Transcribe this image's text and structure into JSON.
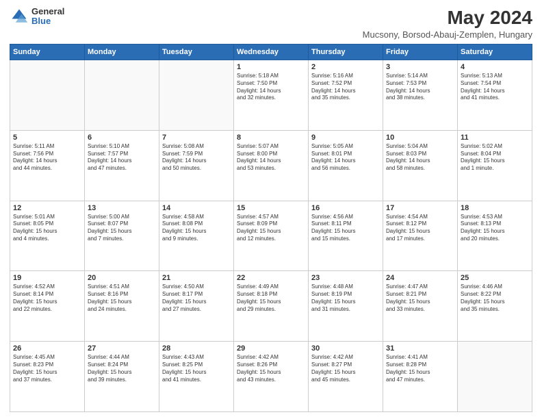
{
  "header": {
    "logo_line1": "General",
    "logo_line2": "Blue",
    "title": "May 2024",
    "subtitle": "Mucsony, Borsod-Abauj-Zemplen, Hungary"
  },
  "weekdays": [
    "Sunday",
    "Monday",
    "Tuesday",
    "Wednesday",
    "Thursday",
    "Friday",
    "Saturday"
  ],
  "weeks": [
    [
      {
        "day": "",
        "info": ""
      },
      {
        "day": "",
        "info": ""
      },
      {
        "day": "",
        "info": ""
      },
      {
        "day": "1",
        "info": "Sunrise: 5:18 AM\nSunset: 7:50 PM\nDaylight: 14 hours\nand 32 minutes."
      },
      {
        "day": "2",
        "info": "Sunrise: 5:16 AM\nSunset: 7:52 PM\nDaylight: 14 hours\nand 35 minutes."
      },
      {
        "day": "3",
        "info": "Sunrise: 5:14 AM\nSunset: 7:53 PM\nDaylight: 14 hours\nand 38 minutes."
      },
      {
        "day": "4",
        "info": "Sunrise: 5:13 AM\nSunset: 7:54 PM\nDaylight: 14 hours\nand 41 minutes."
      }
    ],
    [
      {
        "day": "5",
        "info": "Sunrise: 5:11 AM\nSunset: 7:56 PM\nDaylight: 14 hours\nand 44 minutes."
      },
      {
        "day": "6",
        "info": "Sunrise: 5:10 AM\nSunset: 7:57 PM\nDaylight: 14 hours\nand 47 minutes."
      },
      {
        "day": "7",
        "info": "Sunrise: 5:08 AM\nSunset: 7:59 PM\nDaylight: 14 hours\nand 50 minutes."
      },
      {
        "day": "8",
        "info": "Sunrise: 5:07 AM\nSunset: 8:00 PM\nDaylight: 14 hours\nand 53 minutes."
      },
      {
        "day": "9",
        "info": "Sunrise: 5:05 AM\nSunset: 8:01 PM\nDaylight: 14 hours\nand 56 minutes."
      },
      {
        "day": "10",
        "info": "Sunrise: 5:04 AM\nSunset: 8:03 PM\nDaylight: 14 hours\nand 58 minutes."
      },
      {
        "day": "11",
        "info": "Sunrise: 5:02 AM\nSunset: 8:04 PM\nDaylight: 15 hours\nand 1 minute."
      }
    ],
    [
      {
        "day": "12",
        "info": "Sunrise: 5:01 AM\nSunset: 8:05 PM\nDaylight: 15 hours\nand 4 minutes."
      },
      {
        "day": "13",
        "info": "Sunrise: 5:00 AM\nSunset: 8:07 PM\nDaylight: 15 hours\nand 7 minutes."
      },
      {
        "day": "14",
        "info": "Sunrise: 4:58 AM\nSunset: 8:08 PM\nDaylight: 15 hours\nand 9 minutes."
      },
      {
        "day": "15",
        "info": "Sunrise: 4:57 AM\nSunset: 8:09 PM\nDaylight: 15 hours\nand 12 minutes."
      },
      {
        "day": "16",
        "info": "Sunrise: 4:56 AM\nSunset: 8:11 PM\nDaylight: 15 hours\nand 15 minutes."
      },
      {
        "day": "17",
        "info": "Sunrise: 4:54 AM\nSunset: 8:12 PM\nDaylight: 15 hours\nand 17 minutes."
      },
      {
        "day": "18",
        "info": "Sunrise: 4:53 AM\nSunset: 8:13 PM\nDaylight: 15 hours\nand 20 minutes."
      }
    ],
    [
      {
        "day": "19",
        "info": "Sunrise: 4:52 AM\nSunset: 8:14 PM\nDaylight: 15 hours\nand 22 minutes."
      },
      {
        "day": "20",
        "info": "Sunrise: 4:51 AM\nSunset: 8:16 PM\nDaylight: 15 hours\nand 24 minutes."
      },
      {
        "day": "21",
        "info": "Sunrise: 4:50 AM\nSunset: 8:17 PM\nDaylight: 15 hours\nand 27 minutes."
      },
      {
        "day": "22",
        "info": "Sunrise: 4:49 AM\nSunset: 8:18 PM\nDaylight: 15 hours\nand 29 minutes."
      },
      {
        "day": "23",
        "info": "Sunrise: 4:48 AM\nSunset: 8:19 PM\nDaylight: 15 hours\nand 31 minutes."
      },
      {
        "day": "24",
        "info": "Sunrise: 4:47 AM\nSunset: 8:21 PM\nDaylight: 15 hours\nand 33 minutes."
      },
      {
        "day": "25",
        "info": "Sunrise: 4:46 AM\nSunset: 8:22 PM\nDaylight: 15 hours\nand 35 minutes."
      }
    ],
    [
      {
        "day": "26",
        "info": "Sunrise: 4:45 AM\nSunset: 8:23 PM\nDaylight: 15 hours\nand 37 minutes."
      },
      {
        "day": "27",
        "info": "Sunrise: 4:44 AM\nSunset: 8:24 PM\nDaylight: 15 hours\nand 39 minutes."
      },
      {
        "day": "28",
        "info": "Sunrise: 4:43 AM\nSunset: 8:25 PM\nDaylight: 15 hours\nand 41 minutes."
      },
      {
        "day": "29",
        "info": "Sunrise: 4:42 AM\nSunset: 8:26 PM\nDaylight: 15 hours\nand 43 minutes."
      },
      {
        "day": "30",
        "info": "Sunrise: 4:42 AM\nSunset: 8:27 PM\nDaylight: 15 hours\nand 45 minutes."
      },
      {
        "day": "31",
        "info": "Sunrise: 4:41 AM\nSunset: 8:28 PM\nDaylight: 15 hours\nand 47 minutes."
      },
      {
        "day": "",
        "info": ""
      }
    ]
  ]
}
